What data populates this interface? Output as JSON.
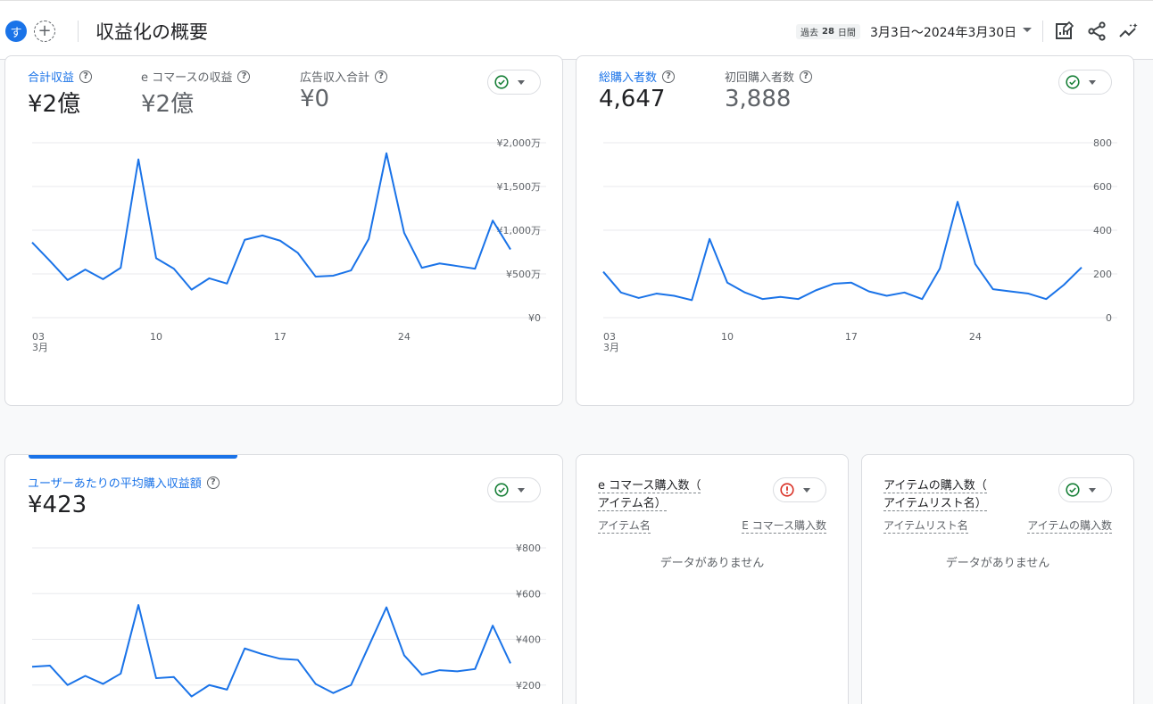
{
  "header": {
    "avatar": "す",
    "title": "収益化の概要",
    "period_prefix": "過去",
    "period_num": "28",
    "period_suffix": "日間",
    "date_range": "3月3日～2024年3月30日"
  },
  "colors": {
    "accent": "#1a73e8",
    "ok": "#188038",
    "error": "#d93025"
  },
  "card1": {
    "metrics": [
      {
        "label": "合計収益",
        "value": "¥2億"
      },
      {
        "label": "e コマースの収益",
        "value": "¥2億"
      },
      {
        "label": "広告収入合計",
        "value": "¥0"
      }
    ],
    "chart_data": {
      "type": "line",
      "x": [
        3,
        4,
        5,
        6,
        7,
        8,
        9,
        10,
        11,
        12,
        13,
        14,
        15,
        16,
        17,
        18,
        19,
        20,
        21,
        22,
        23,
        24,
        25,
        26,
        27,
        28,
        29,
        30
      ],
      "series": [
        {
          "values": [
            8.6,
            6.5,
            4.3,
            5.5,
            4.4,
            5.7,
            18.1,
            6.8,
            5.6,
            3.2,
            4.5,
            3.9,
            8.9,
            9.4,
            8.8,
            7.4,
            4.7,
            4.8,
            5.4,
            9.0,
            18.8,
            9.7,
            5.7,
            6.2,
            5.9,
            5.6,
            11.1,
            7.8
          ]
        }
      ],
      "x_ticks": [
        "03",
        "10",
        "17",
        "24"
      ],
      "x_sub": "3月",
      "y_ticks": [
        "¥2,000万",
        "¥1,500万",
        "¥1,000万",
        "¥500万",
        "¥0"
      ],
      "ylim": [
        0,
        20
      ]
    }
  },
  "card2": {
    "metrics": [
      {
        "label": "総購入者数",
        "value": "4,647"
      },
      {
        "label": "初回購入者数",
        "value": "3,888"
      }
    ],
    "chart_data": {
      "type": "line",
      "x": [
        3,
        4,
        5,
        6,
        7,
        8,
        9,
        10,
        11,
        12,
        13,
        14,
        15,
        16,
        17,
        18,
        19,
        20,
        21,
        22,
        23,
        24,
        25,
        26,
        27,
        28,
        29,
        30
      ],
      "series": [
        {
          "values": [
            210,
            115,
            90,
            110,
            100,
            80,
            360,
            160,
            115,
            85,
            95,
            85,
            125,
            155,
            160,
            120,
            100,
            115,
            85,
            225,
            530,
            245,
            130,
            120,
            110,
            85,
            150,
            230
          ]
        }
      ],
      "x_ticks": [
        "03",
        "10",
        "17",
        "24"
      ],
      "x_sub": "3月",
      "y_ticks": [
        "800",
        "600",
        "400",
        "200",
        "0"
      ],
      "ylim": [
        0,
        800
      ]
    }
  },
  "card3": {
    "metrics": [
      {
        "label": "ユーザーあたりの平均購入収益額",
        "value": "¥423"
      }
    ],
    "chart_data": {
      "type": "line",
      "x": [
        3,
        4,
        5,
        6,
        7,
        8,
        9,
        10,
        11,
        12,
        13,
        14,
        15,
        16,
        17,
        18,
        19,
        20,
        21,
        22,
        23,
        24,
        25,
        26,
        27,
        28,
        29,
        30
      ],
      "series": [
        {
          "values": [
            280,
            285,
            200,
            240,
            205,
            250,
            550,
            230,
            235,
            150,
            200,
            180,
            360,
            335,
            315,
            310,
            205,
            165,
            200,
            370,
            540,
            330,
            245,
            265,
            260,
            270,
            460,
            295
          ]
        }
      ],
      "y_ticks": [
        "¥800",
        "¥600",
        "¥400",
        "¥200"
      ],
      "ylim": [
        0,
        800
      ]
    }
  },
  "card4": {
    "title_line1": "e コマース購入数（",
    "title_line2": "アイテム名）",
    "col1": "アイテム名",
    "col2": "E コマース購入数",
    "empty": "データがありません"
  },
  "card5": {
    "title_line1": "アイテムの購入数（",
    "title_line2": "アイテムリスト名）",
    "col1": "アイテムリスト名",
    "col2": "アイテムの購入数",
    "empty": "データがありません"
  }
}
